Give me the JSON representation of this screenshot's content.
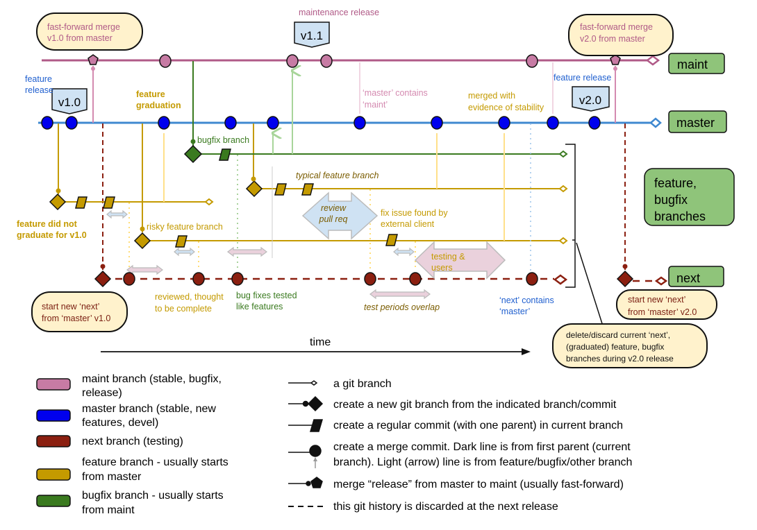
{
  "colors": {
    "maint": "#b05a87",
    "master": "#3f88d0",
    "next": "#7a1f12",
    "feature": "#c49a00",
    "bugfix": "#3a7a1f",
    "label_box": "#8fc47a",
    "callout": "#fff2cc",
    "tag": "#cfe2f3"
  },
  "branch_labels": {
    "maint": "maint",
    "master": "master",
    "features": [
      "feature,",
      "bugfix",
      "branches"
    ],
    "next": "next"
  },
  "tags": {
    "v10": "v1.0",
    "v11": "v1.1",
    "v20": "v2.0"
  },
  "callouts": {
    "ff_v10": [
      "fast-forward merge",
      "v1.0 from master"
    ],
    "ff_v20": [
      "fast-forward merge",
      "v2.0 from master"
    ],
    "next_v10": [
      "start new ‘next’",
      "from ‘master’ v1.0"
    ],
    "next_v20": [
      "start new ‘next’",
      "from ‘master’ v2.0"
    ],
    "discard": [
      "delete/discard  current ‘next’,",
      "(graduated) feature, bugfix",
      "branches during v2.0 release"
    ]
  },
  "annotations": {
    "maintenance_release": "maintenance release",
    "feature_release_1": [
      "feature",
      "release"
    ],
    "feature_graduation": [
      "feature",
      "graduation"
    ],
    "bugfix_branch": "bugfix branch",
    "master_contains_maint": [
      "‘master’ contains",
      "‘maint’"
    ],
    "merged_stability": [
      "merged with",
      "evidence of stability"
    ],
    "feature_release_2": "feature release",
    "typical_feature": "typical feature branch",
    "review": [
      "review",
      "pull req"
    ],
    "fix_issue": [
      "fix issue found by",
      "external client"
    ],
    "risky": "risky feature branch",
    "not_graduate": [
      "feature did not",
      "graduate for v1.0"
    ],
    "testing_users": [
      "testing &",
      "users"
    ],
    "reviewed": [
      "reviewed, thought",
      "to be complete"
    ],
    "bug_fixes_tested": [
      "bug fixes tested",
      "like features"
    ],
    "test_overlap": "test periods overlap",
    "next_contains_master": [
      "‘next’ contains",
      "‘master’"
    ],
    "time": "time"
  },
  "legend_colors": [
    {
      "color": "#c77ba4",
      "label": [
        "maint branch (stable, bugfix,",
        "release)"
      ]
    },
    {
      "color": "#0000ee",
      "label": [
        "master branch (stable, new",
        "features, devel)"
      ]
    },
    {
      "color": "#8b1f10",
      "label": [
        "next branch (testing)"
      ]
    },
    {
      "color": "#c49a00",
      "label": [
        "feature branch - usually starts",
        "from master"
      ]
    },
    {
      "color": "#3a7a1f",
      "label": [
        "bugfix branch - usually starts",
        "from maint"
      ]
    }
  ],
  "legend_symbols": [
    {
      "icon": "branch-end-icon",
      "label": [
        "a git branch"
      ]
    },
    {
      "icon": "new-branch-icon",
      "label": [
        "create a new git branch from the indicated branch/commit"
      ]
    },
    {
      "icon": "commit-icon",
      "label": [
        "create a regular commit (with one parent) in current branch"
      ]
    },
    {
      "icon": "merge-commit-icon",
      "label": [
        "create a merge commit. Dark line is from first parent (current",
        "branch). Light (arrow) line is from feature/bugfix/other branch"
      ]
    },
    {
      "icon": "release-merge-icon",
      "label": [
        "merge “release” from master to maint (usually fast-forward)"
      ]
    },
    {
      "icon": "dashed-line-icon",
      "label": [
        "this git history is discarded at the next release"
      ]
    }
  ]
}
